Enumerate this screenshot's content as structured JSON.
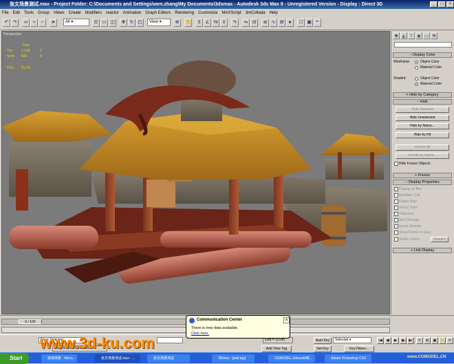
{
  "window": {
    "title": "张文场景测试.max    - Project Folder: C:\\Documents and Settings\\wen.zhang\\My Documents\\3dsmax    - Autodesk 3ds Max 9    - Unregistered Version    - Display : Direct 3D"
  },
  "watermark": "www.3d-ku.com",
  "menu": [
    "File",
    "Edit",
    "Tools",
    "Group",
    "Views",
    "Create",
    "Modifiers",
    "reactor",
    "Animation",
    "Graph Editors",
    "Rendering",
    "Customize",
    "MAXScript",
    "3mCollada",
    "Help"
  ],
  "toolbar": {
    "selection_filter": "All",
    "ref_coord": "View"
  },
  "viewport": {
    "label": "Perspective",
    "stats": {
      "total_label": "Total",
      "tris_label": "Tris",
      "tris_total": "1,158",
      "tris_sel": "0",
      "verts_label": "Verts",
      "verts_total": "835",
      "verts_sel": "0",
      "fps_label": "FPS:",
      "fps_value": "81.00"
    }
  },
  "command_panel": {
    "display_color": {
      "title": "Display Color",
      "wireframe_label": "Wireframe:",
      "shaded_label": "Shaded:",
      "object_color": "Object Color",
      "material_color": "Material Color"
    },
    "hide_by_category": "Hide by Category",
    "hide": {
      "title": "Hide",
      "hide_selected": "Hide Selected",
      "hide_unselected": "Hide Unselected",
      "hide_by_name": "Hide by Name...",
      "hide_by_hit": "Hide by Hit",
      "unhide_all": "Unhide All",
      "unhide_by_name": "Unhide by Name...",
      "hide_frozen": "Hide Frozen Objects"
    },
    "freeze": "Freeze",
    "display_properties": {
      "title": "Display Properties",
      "items": [
        "Display as Box",
        "Backface Cull",
        "Edges Only",
        "Vertex Ticks",
        "Trajectory",
        "See-Through",
        "Ignore Extents",
        "Show Frozen in Gray",
        "Vertex Colors"
      ],
      "shaded_btn": "Shaded"
    },
    "link_display": "Link Display"
  },
  "timeline": {
    "frame": "0 / 100"
  },
  "status": {
    "selection": "None Selected",
    "hint": "Drag to select and move",
    "grid": "Grid = 10.0m",
    "add_time_tag": "Add Time Tag",
    "auto_key": "Auto Key",
    "set_key": "Set Key",
    "key_mode": "Selected",
    "key_filters": "Key Filters..."
  },
  "balloon": {
    "title": "Communication Center",
    "message": "There is new data available.",
    "link": "Click here."
  },
  "taskbar": {
    "start": "Start",
    "tasks": [
      "游戏场景 - Micro...",
      "张文场景测试.max - ...",
      "张文场景测试",
      "3ltView - [wall.tga]",
      "CGMODEL 3dmodel库...",
      "Adobe Photoshop CS3"
    ],
    "site": "www.CGMODEL.CN"
  },
  "colors": {
    "titlebar": "#0a246a",
    "viewport_bg": "#7b7b7b",
    "watermark": "#ff8a00",
    "taskbar": "#245edb"
  }
}
